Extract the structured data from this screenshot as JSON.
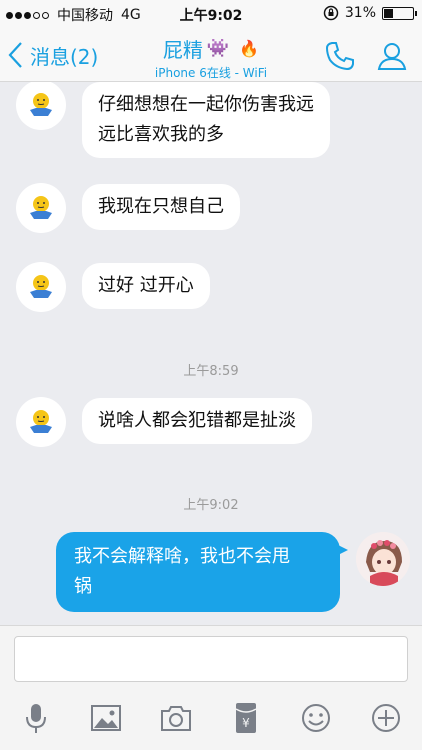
{
  "status_bar": {
    "carrier": "中国移动",
    "network": "4G",
    "time": "上午9:02",
    "battery_percent": "31%",
    "battery_level": 0.31
  },
  "nav": {
    "back_label": "消息(2)",
    "title": "屁精",
    "subtitle": "iPhone 6在线 - WiFi",
    "accent_color": "#1aa0e0"
  },
  "messages": [
    {
      "side": "left",
      "text_lines": [
        "仔细想想在一起你伤害我远",
        "远比喜欢我的多"
      ]
    },
    {
      "side": "left",
      "text_lines": [
        "我现在只想自己"
      ]
    },
    {
      "side": "left",
      "text_lines": [
        "过好 过开心"
      ]
    },
    {
      "type": "timestamp",
      "text": "上午8:59"
    },
    {
      "side": "left",
      "text_lines": [
        "说啥人都会犯错都是扯淡"
      ]
    },
    {
      "type": "timestamp",
      "text": "上午9:02"
    },
    {
      "side": "right",
      "text_lines": [
        "我不会解释啥，我也不会甩",
        "锅"
      ]
    }
  ],
  "input": {
    "placeholder": ""
  },
  "toolbar": {
    "icons": [
      "microphone-icon",
      "image-icon",
      "camera-icon",
      "red-packet-icon",
      "emoji-icon",
      "plus-icon"
    ]
  }
}
